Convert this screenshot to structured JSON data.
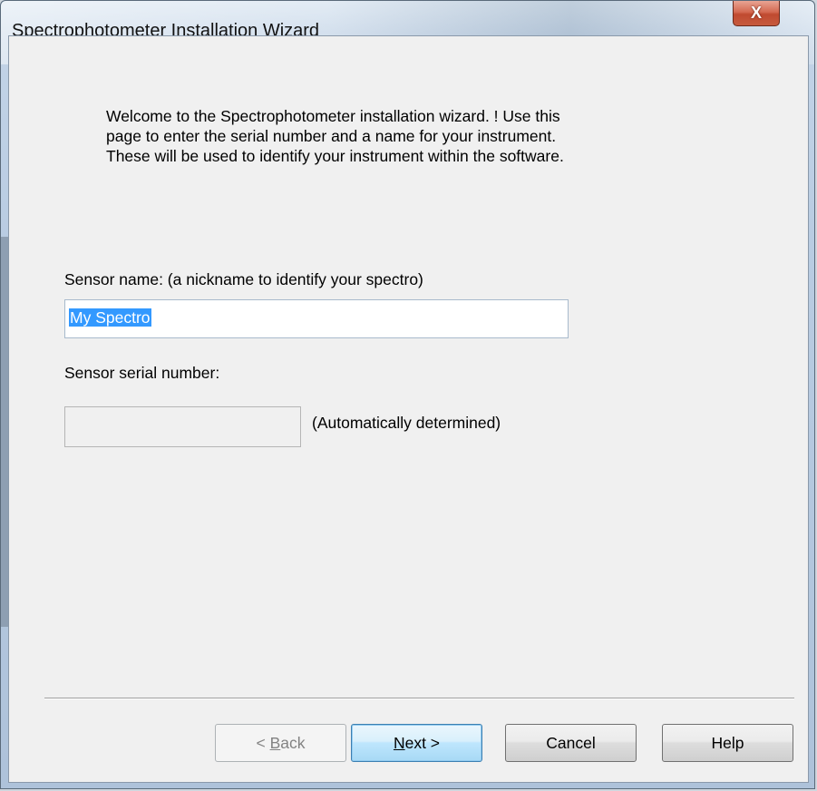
{
  "window": {
    "title": "Spectrophotometer Installation Wizard",
    "close_glyph": "X"
  },
  "wizard": {
    "intro": "Welcome to the Spectrophotometer installation wizard. !  Use this\npage to enter the serial number and a name for your instrument.\nThese will be used to identify your instrument within the software.",
    "sensor_name_label": "Sensor name: (a nickname to identify your spectro)",
    "sensor_name_value": "My Spectro",
    "serial_label": "Sensor serial number:",
    "serial_value": "",
    "serial_note": "(Automatically determined)"
  },
  "buttons": {
    "back": {
      "prefix": "< ",
      "accel": "B",
      "rest": "ack",
      "enabled": false
    },
    "next": {
      "accel": "N",
      "rest": "ext >",
      "default": true
    },
    "cancel": "Cancel",
    "help": "Help"
  },
  "icons": {
    "close": "close-icon"
  },
  "colors": {
    "selection": "#3399ff",
    "close_button": "#c75a3f",
    "dialog_background": "#f0f0f0"
  }
}
